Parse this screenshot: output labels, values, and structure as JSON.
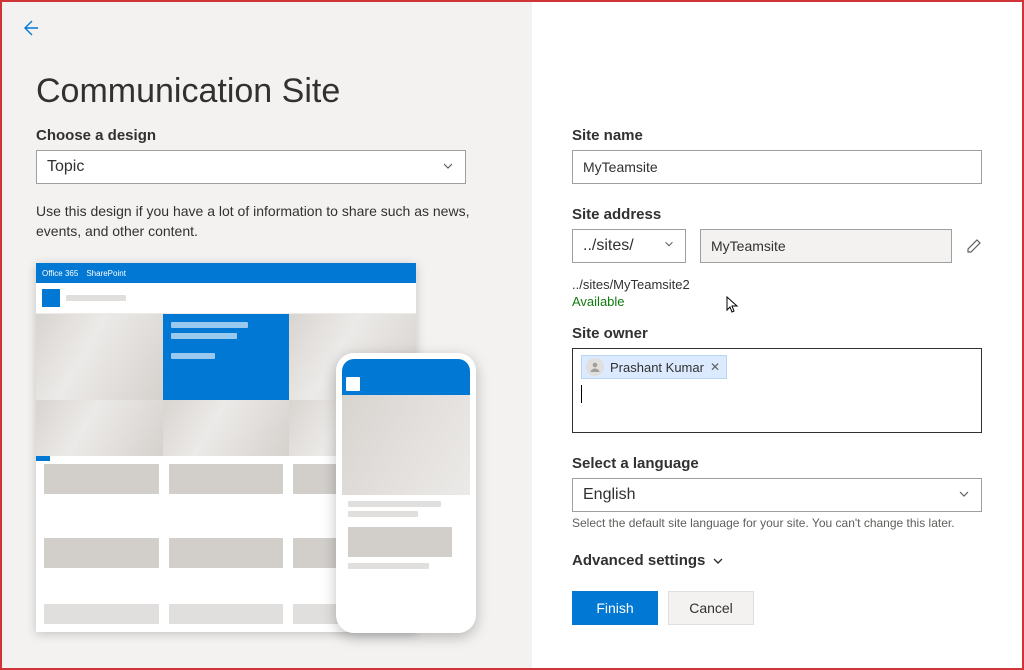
{
  "page_title": "Communication Site",
  "design": {
    "label": "Choose a design",
    "selected": "Topic",
    "description": "Use this design if you have a lot of information to share such as news, events, and other content."
  },
  "preview_bar": {
    "brand": "Office 365",
    "app": "SharePoint"
  },
  "form": {
    "site_name": {
      "label": "Site name",
      "value": "MyTeamsite"
    },
    "site_address": {
      "label": "Site address",
      "prefix_selected": "../sites/",
      "value": "MyTeamsite",
      "resolved_path": "../sites/MyTeamsite2",
      "status": "Available"
    },
    "owner": {
      "label": "Site owner",
      "person": "Prashant Kumar"
    },
    "language": {
      "label": "Select a language",
      "selected": "English",
      "help": "Select the default site language for your site. You can't change this later."
    },
    "advanced_label": "Advanced settings",
    "buttons": {
      "finish": "Finish",
      "cancel": "Cancel"
    }
  }
}
